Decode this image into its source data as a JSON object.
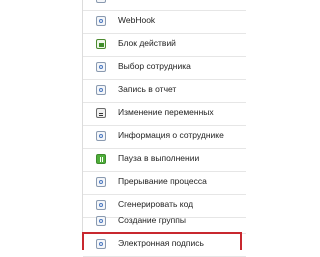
{
  "items": [
    {
      "label": "WebHook",
      "icon": "webhook-icon"
    },
    {
      "label": "Блок действий",
      "icon": "action-block-icon"
    },
    {
      "label": "Выбор сотрудника",
      "icon": "employee-select-icon"
    },
    {
      "label": "Запись в отчет",
      "icon": "report-entry-icon"
    },
    {
      "label": "Изменение переменных",
      "icon": "variables-icon"
    },
    {
      "label": "Информация о сотруднике",
      "icon": "employee-info-icon"
    },
    {
      "label": "Пауза в выполнении",
      "icon": "pause-icon"
    },
    {
      "label": "Прерывание процесса",
      "icon": "process-interrupt-icon"
    },
    {
      "label": "Сгенерировать код",
      "icon": "generate-code-icon"
    },
    {
      "label": "Создание группы",
      "icon": "create-group-icon"
    },
    {
      "label": "Электронная подпись",
      "icon": "e-signature-icon"
    }
  ],
  "highlight_color": "#c8282f"
}
